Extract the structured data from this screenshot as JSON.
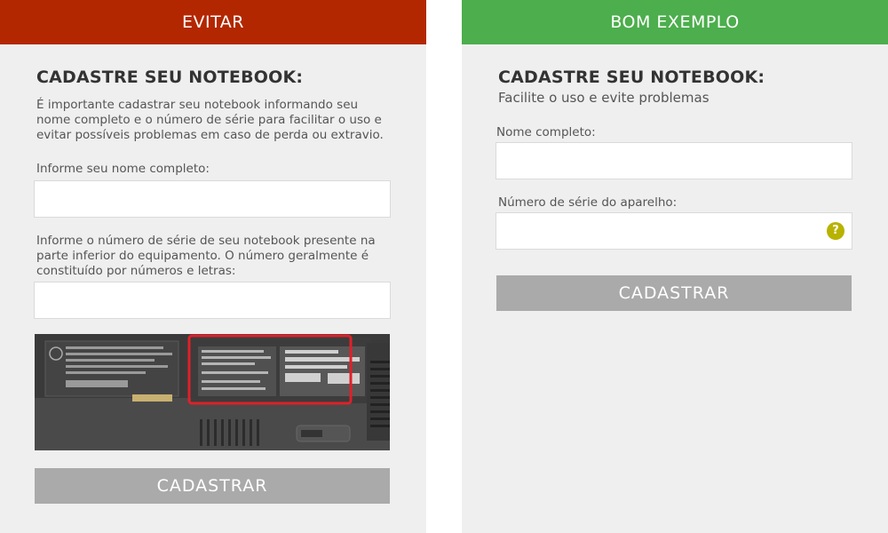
{
  "left": {
    "banner": "EVITAR",
    "title": "CADASTRE SEU NOTEBOOK:",
    "description": [
      "É importante cadastrar seu notebook informando seu",
      "nome completo e o número de série para facilitar o uso e",
      "evitar possíveis problemas em caso de perda ou extravio."
    ],
    "name_label": "Informe seu nome completo:",
    "serial_label": [
      "Informe o número de série de seu notebook presente na",
      "parte inferior do equipamento. O número geralmente é",
      "constituído por números e letras:"
    ],
    "button": "CADASTRAR"
  },
  "right": {
    "banner": "BOM EXEMPLO",
    "title": "CADASTRE SEU NOTEBOOK:",
    "subtitle": "Facilite o uso e evite problemas",
    "name_label": "Nome completo:",
    "serial_label": "Número de série do aparelho:",
    "help_icon": "?",
    "button": "CADASTRAR"
  },
  "colors": {
    "bad_banner": "#b32700",
    "good_banner": "#4cae4c",
    "button": "#aaaaaa",
    "help": "#b8b200",
    "highlight": "#e0202a"
  }
}
